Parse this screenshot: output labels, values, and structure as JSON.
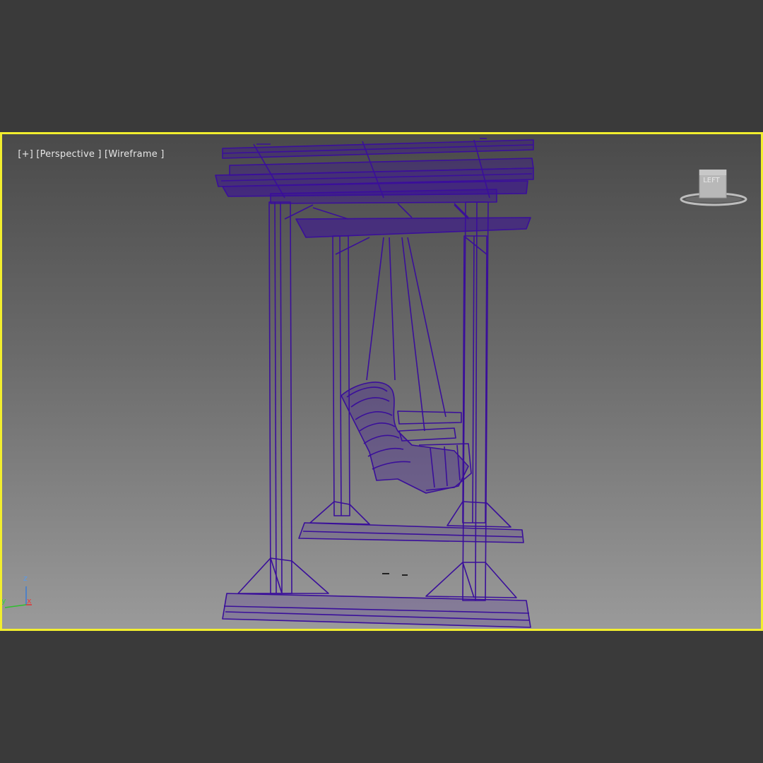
{
  "viewport": {
    "label_parts": [
      "[+]",
      "[Perspective ]",
      "[Wireframe ]"
    ],
    "border_color": "#f2ee2e",
    "wire_color": "#3a0f9a"
  },
  "viewcube": {
    "face_label": "LEFT",
    "icon": "viewcube-icon"
  },
  "axis_gizmo": {
    "z": "z",
    "y": "y",
    "x": "x",
    "colors": {
      "z": "#3a7bd5",
      "y": "#2fbf2f",
      "x": "#e03030"
    }
  },
  "model": {
    "icon": "porch-swing-pergola-wireframe"
  }
}
